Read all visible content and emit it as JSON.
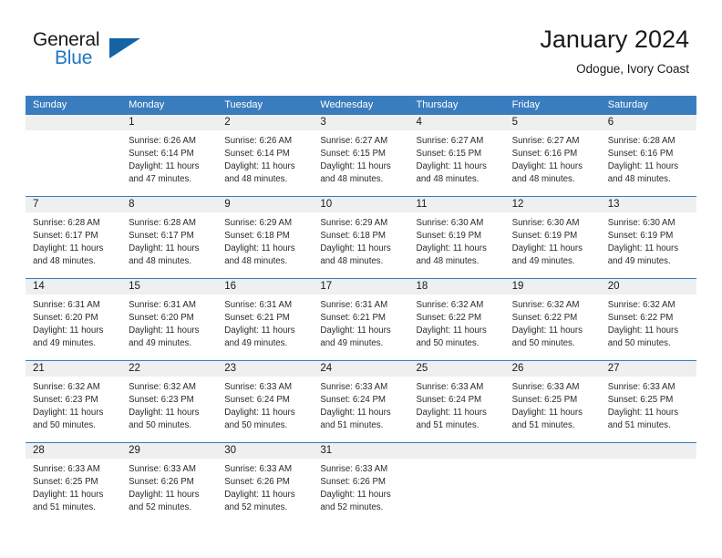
{
  "brand": {
    "name_part1": "General",
    "name_part2": "Blue",
    "flag_icon": "blue-triangle-flag-icon"
  },
  "header": {
    "title": "January 2024",
    "location": "Odogue, Ivory Coast"
  },
  "calendar": {
    "weekday_headers": [
      "Sunday",
      "Monday",
      "Tuesday",
      "Wednesday",
      "Thursday",
      "Friday",
      "Saturday"
    ],
    "colors": {
      "header_blue": "#3a7dbf",
      "day_band_gray": "#efefef",
      "brand_blue": "#1f77c4",
      "text": "#1a1a1a"
    },
    "weeks": [
      [
        {
          "day": "",
          "sunrise": "",
          "sunset": "",
          "daylight_line1": "",
          "daylight_line2": ""
        },
        {
          "day": "1",
          "sunrise": "Sunrise: 6:26 AM",
          "sunset": "Sunset: 6:14 PM",
          "daylight_line1": "Daylight: 11 hours",
          "daylight_line2": "and 47 minutes."
        },
        {
          "day": "2",
          "sunrise": "Sunrise: 6:26 AM",
          "sunset": "Sunset: 6:14 PM",
          "daylight_line1": "Daylight: 11 hours",
          "daylight_line2": "and 48 minutes."
        },
        {
          "day": "3",
          "sunrise": "Sunrise: 6:27 AM",
          "sunset": "Sunset: 6:15 PM",
          "daylight_line1": "Daylight: 11 hours",
          "daylight_line2": "and 48 minutes."
        },
        {
          "day": "4",
          "sunrise": "Sunrise: 6:27 AM",
          "sunset": "Sunset: 6:15 PM",
          "daylight_line1": "Daylight: 11 hours",
          "daylight_line2": "and 48 minutes."
        },
        {
          "day": "5",
          "sunrise": "Sunrise: 6:27 AM",
          "sunset": "Sunset: 6:16 PM",
          "daylight_line1": "Daylight: 11 hours",
          "daylight_line2": "and 48 minutes."
        },
        {
          "day": "6",
          "sunrise": "Sunrise: 6:28 AM",
          "sunset": "Sunset: 6:16 PM",
          "daylight_line1": "Daylight: 11 hours",
          "daylight_line2": "and 48 minutes."
        }
      ],
      [
        {
          "day": "7",
          "sunrise": "Sunrise: 6:28 AM",
          "sunset": "Sunset: 6:17 PM",
          "daylight_line1": "Daylight: 11 hours",
          "daylight_line2": "and 48 minutes."
        },
        {
          "day": "8",
          "sunrise": "Sunrise: 6:28 AM",
          "sunset": "Sunset: 6:17 PM",
          "daylight_line1": "Daylight: 11 hours",
          "daylight_line2": "and 48 minutes."
        },
        {
          "day": "9",
          "sunrise": "Sunrise: 6:29 AM",
          "sunset": "Sunset: 6:18 PM",
          "daylight_line1": "Daylight: 11 hours",
          "daylight_line2": "and 48 minutes."
        },
        {
          "day": "10",
          "sunrise": "Sunrise: 6:29 AM",
          "sunset": "Sunset: 6:18 PM",
          "daylight_line1": "Daylight: 11 hours",
          "daylight_line2": "and 48 minutes."
        },
        {
          "day": "11",
          "sunrise": "Sunrise: 6:30 AM",
          "sunset": "Sunset: 6:19 PM",
          "daylight_line1": "Daylight: 11 hours",
          "daylight_line2": "and 48 minutes."
        },
        {
          "day": "12",
          "sunrise": "Sunrise: 6:30 AM",
          "sunset": "Sunset: 6:19 PM",
          "daylight_line1": "Daylight: 11 hours",
          "daylight_line2": "and 49 minutes."
        },
        {
          "day": "13",
          "sunrise": "Sunrise: 6:30 AM",
          "sunset": "Sunset: 6:19 PM",
          "daylight_line1": "Daylight: 11 hours",
          "daylight_line2": "and 49 minutes."
        }
      ],
      [
        {
          "day": "14",
          "sunrise": "Sunrise: 6:31 AM",
          "sunset": "Sunset: 6:20 PM",
          "daylight_line1": "Daylight: 11 hours",
          "daylight_line2": "and 49 minutes."
        },
        {
          "day": "15",
          "sunrise": "Sunrise: 6:31 AM",
          "sunset": "Sunset: 6:20 PM",
          "daylight_line1": "Daylight: 11 hours",
          "daylight_line2": "and 49 minutes."
        },
        {
          "day": "16",
          "sunrise": "Sunrise: 6:31 AM",
          "sunset": "Sunset: 6:21 PM",
          "daylight_line1": "Daylight: 11 hours",
          "daylight_line2": "and 49 minutes."
        },
        {
          "day": "17",
          "sunrise": "Sunrise: 6:31 AM",
          "sunset": "Sunset: 6:21 PM",
          "daylight_line1": "Daylight: 11 hours",
          "daylight_line2": "and 49 minutes."
        },
        {
          "day": "18",
          "sunrise": "Sunrise: 6:32 AM",
          "sunset": "Sunset: 6:22 PM",
          "daylight_line1": "Daylight: 11 hours",
          "daylight_line2": "and 50 minutes."
        },
        {
          "day": "19",
          "sunrise": "Sunrise: 6:32 AM",
          "sunset": "Sunset: 6:22 PM",
          "daylight_line1": "Daylight: 11 hours",
          "daylight_line2": "and 50 minutes."
        },
        {
          "day": "20",
          "sunrise": "Sunrise: 6:32 AM",
          "sunset": "Sunset: 6:22 PM",
          "daylight_line1": "Daylight: 11 hours",
          "daylight_line2": "and 50 minutes."
        }
      ],
      [
        {
          "day": "21",
          "sunrise": "Sunrise: 6:32 AM",
          "sunset": "Sunset: 6:23 PM",
          "daylight_line1": "Daylight: 11 hours",
          "daylight_line2": "and 50 minutes."
        },
        {
          "day": "22",
          "sunrise": "Sunrise: 6:32 AM",
          "sunset": "Sunset: 6:23 PM",
          "daylight_line1": "Daylight: 11 hours",
          "daylight_line2": "and 50 minutes."
        },
        {
          "day": "23",
          "sunrise": "Sunrise: 6:33 AM",
          "sunset": "Sunset: 6:24 PM",
          "daylight_line1": "Daylight: 11 hours",
          "daylight_line2": "and 50 minutes."
        },
        {
          "day": "24",
          "sunrise": "Sunrise: 6:33 AM",
          "sunset": "Sunset: 6:24 PM",
          "daylight_line1": "Daylight: 11 hours",
          "daylight_line2": "and 51 minutes."
        },
        {
          "day": "25",
          "sunrise": "Sunrise: 6:33 AM",
          "sunset": "Sunset: 6:24 PM",
          "daylight_line1": "Daylight: 11 hours",
          "daylight_line2": "and 51 minutes."
        },
        {
          "day": "26",
          "sunrise": "Sunrise: 6:33 AM",
          "sunset": "Sunset: 6:25 PM",
          "daylight_line1": "Daylight: 11 hours",
          "daylight_line2": "and 51 minutes."
        },
        {
          "day": "27",
          "sunrise": "Sunrise: 6:33 AM",
          "sunset": "Sunset: 6:25 PM",
          "daylight_line1": "Daylight: 11 hours",
          "daylight_line2": "and 51 minutes."
        }
      ],
      [
        {
          "day": "28",
          "sunrise": "Sunrise: 6:33 AM",
          "sunset": "Sunset: 6:25 PM",
          "daylight_line1": "Daylight: 11 hours",
          "daylight_line2": "and 51 minutes."
        },
        {
          "day": "29",
          "sunrise": "Sunrise: 6:33 AM",
          "sunset": "Sunset: 6:26 PM",
          "daylight_line1": "Daylight: 11 hours",
          "daylight_line2": "and 52 minutes."
        },
        {
          "day": "30",
          "sunrise": "Sunrise: 6:33 AM",
          "sunset": "Sunset: 6:26 PM",
          "daylight_line1": "Daylight: 11 hours",
          "daylight_line2": "and 52 minutes."
        },
        {
          "day": "31",
          "sunrise": "Sunrise: 6:33 AM",
          "sunset": "Sunset: 6:26 PM",
          "daylight_line1": "Daylight: 11 hours",
          "daylight_line2": "and 52 minutes."
        },
        {
          "day": "",
          "sunrise": "",
          "sunset": "",
          "daylight_line1": "",
          "daylight_line2": ""
        },
        {
          "day": "",
          "sunrise": "",
          "sunset": "",
          "daylight_line1": "",
          "daylight_line2": ""
        },
        {
          "day": "",
          "sunrise": "",
          "sunset": "",
          "daylight_line1": "",
          "daylight_line2": ""
        }
      ]
    ]
  }
}
